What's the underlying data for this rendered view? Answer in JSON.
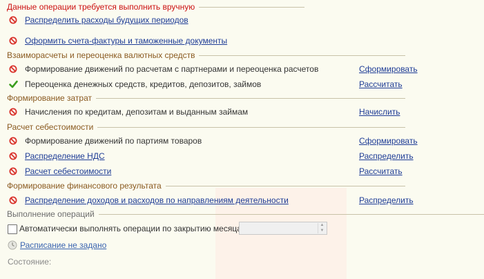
{
  "colors": {
    "background": "#fbfbf0",
    "section_title": "#8a5a20",
    "warning_title": "#cc1111",
    "link": "#1e3c96",
    "stop_icon": "#d9302a",
    "ok_icon": "#3b9e1e"
  },
  "manual": {
    "title": "Данные операции требуется выполнить вручную",
    "items": [
      {
        "label": "Распределить расходы будущих периодов",
        "icon": "stop-icon"
      },
      {
        "label": "Оформить счета-фактуры и таможенные документы",
        "icon": "stop-icon"
      }
    ]
  },
  "settlements": {
    "title": "Взаиморасчеты и переоценка валютных средств",
    "items": [
      {
        "label": "Формирование движений по расчетам с партнерами и переоценка расчетов",
        "action": "Сформировать",
        "icon": "stop-icon"
      },
      {
        "label": "Переоценка денежных средств, кредитов, депозитов, займов",
        "action": "Рассчитать",
        "icon": "check-icon"
      }
    ]
  },
  "costs": {
    "title": "Формирование затрат",
    "items": [
      {
        "label": "Начисления по кредитам, депозитам и выданным займам",
        "action": "Начислить",
        "icon": "stop-icon"
      }
    ]
  },
  "cost_price": {
    "title": "Расчет себестоимости",
    "items": [
      {
        "label": "Формирование движений по партиям товаров",
        "action": "Сформировать",
        "icon": "stop-icon"
      },
      {
        "label": "Распределение НДС",
        "action": "Распределить",
        "icon": "stop-icon"
      },
      {
        "label": "Расчет себестоимости",
        "action": "Рассчитать",
        "icon": "stop-icon"
      }
    ]
  },
  "financial": {
    "title": "Формирование финансового результата",
    "items": [
      {
        "label": "Распределение доходов и расходов по направлениям деятельности",
        "action": "Распределить",
        "icon": "stop-icon"
      }
    ]
  },
  "execution": {
    "title": "Выполнение операций",
    "auto_checkbox_label": "Автоматически выполнять операции по закрытию месяца",
    "auto_checked": false,
    "spin_value": "",
    "schedule_link": "Расписание не задано",
    "state_label": "Состояние:"
  }
}
